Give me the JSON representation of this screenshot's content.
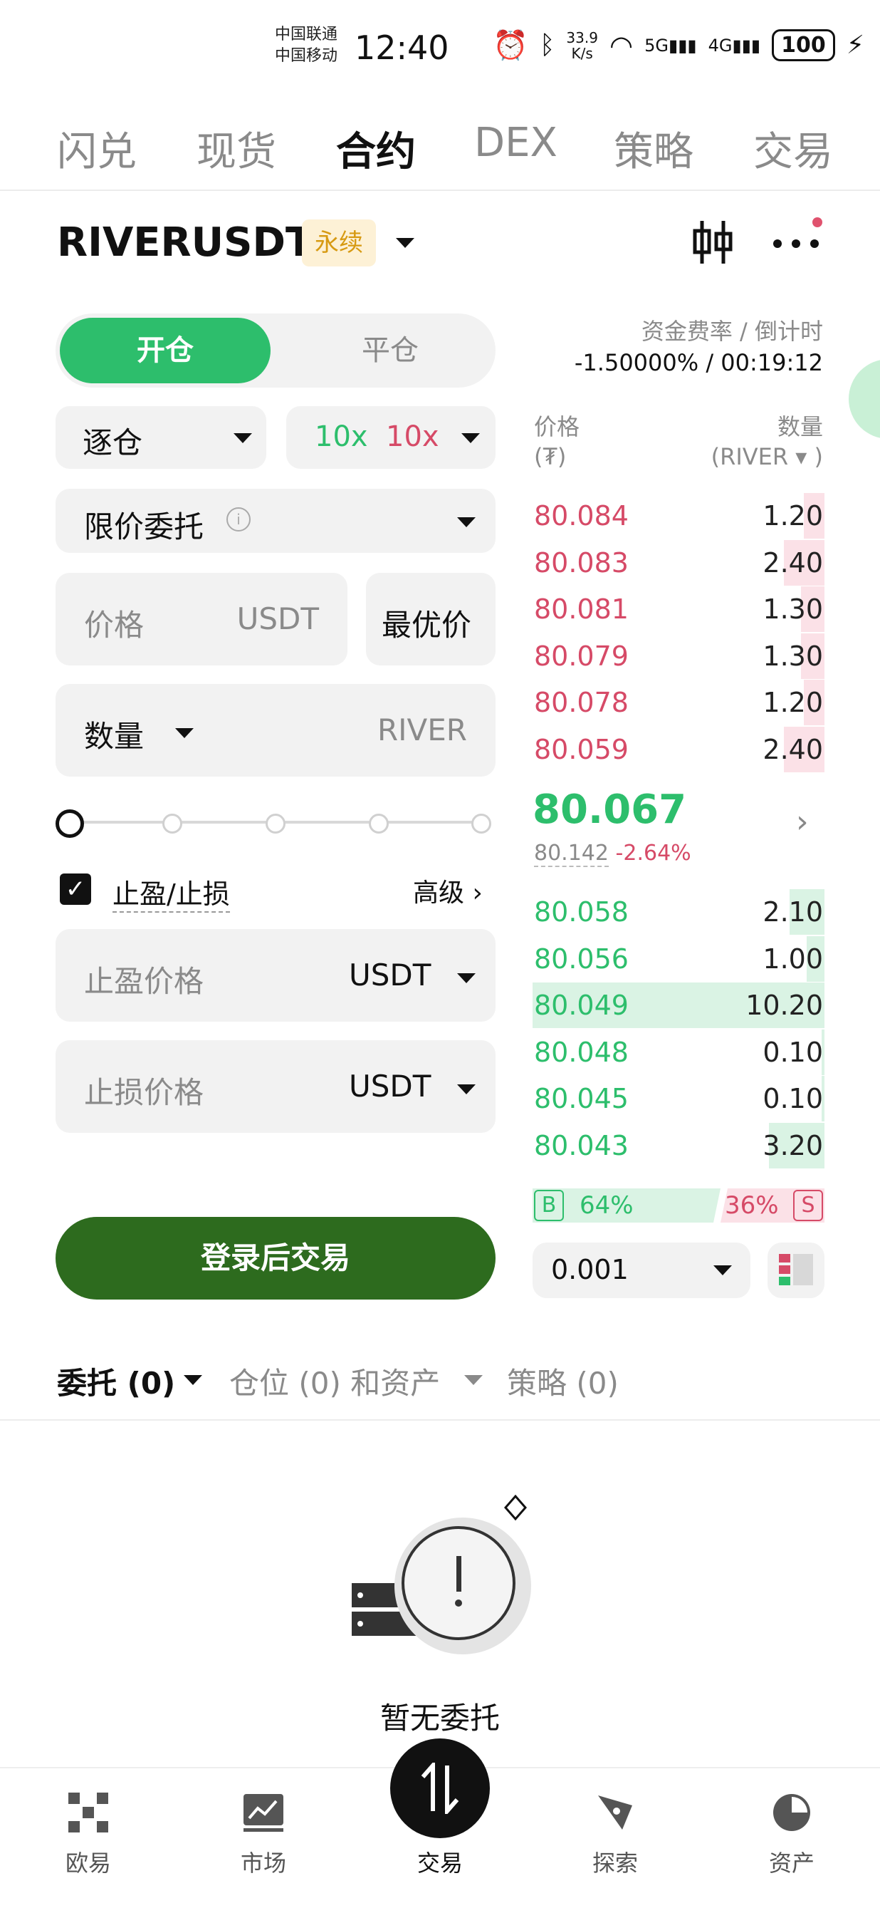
{
  "status_bar": {
    "carrier1": "中国联通",
    "carrier2": "中国移动",
    "time": "12:40",
    "net_speed_value": "33.9",
    "net_speed_unit": "K/s",
    "signal1": "5G",
    "signal2": "4G",
    "battery": "100"
  },
  "top_tabs": [
    "闪兑",
    "现货",
    "合约",
    "DEX",
    "策略",
    "交易"
  ],
  "active_tab": "合约",
  "pair": {
    "symbol": "RIVERUSDT",
    "badge": "永续"
  },
  "funding": {
    "label": "资金费率 / 倒计时",
    "value": "-1.50000% / 00:19:12"
  },
  "form": {
    "open_label": "开仓",
    "close_label": "平仓",
    "margin_mode": "逐仓",
    "leverage_long": "10x",
    "leverage_short": "10x",
    "order_type": "限价委托",
    "price_placeholder": "价格",
    "price_unit": "USDT",
    "best_price": "最优价",
    "qty_label": "数量",
    "qty_unit": "RIVER",
    "slider_percent": 0,
    "tpsl_label": "止盈/止损",
    "tpsl_checked": true,
    "advanced": "高级",
    "tp_placeholder": "止盈价格",
    "tp_unit": "USDT",
    "sl_placeholder": "止损价格",
    "sl_unit": "USDT",
    "login_button": "登录后交易"
  },
  "orderbook": {
    "price_header": "价格",
    "price_unit": "(₮)",
    "qty_header": "数量",
    "qty_unit": "(RIVER",
    "qty_unit_close": ")",
    "asks": [
      {
        "price": "80.084",
        "qty": "1.20",
        "depth": 0.07
      },
      {
        "price": "80.083",
        "qty": "2.40",
        "depth": 0.14
      },
      {
        "price": "80.081",
        "qty": "1.30",
        "depth": 0.08
      },
      {
        "price": "80.079",
        "qty": "1.30",
        "depth": 0.08
      },
      {
        "price": "80.078",
        "qty": "1.20",
        "depth": 0.07
      },
      {
        "price": "80.059",
        "qty": "2.40",
        "depth": 0.14
      }
    ],
    "last_price": "80.067",
    "mark_price": "80.142",
    "change": "-2.64%",
    "bids": [
      {
        "price": "80.058",
        "qty": "2.10",
        "depth": 0.12
      },
      {
        "price": "80.056",
        "qty": "1.00",
        "depth": 0.06
      },
      {
        "price": "80.049",
        "qty": "10.20",
        "depth": 1.0
      },
      {
        "price": "80.048",
        "qty": "0.10",
        "depth": 0.01
      },
      {
        "price": "80.045",
        "qty": "0.10",
        "depth": 0.01
      },
      {
        "price": "80.043",
        "qty": "3.20",
        "depth": 0.19
      }
    ],
    "buy_tag": "B",
    "buy_pct": "64%",
    "sell_pct": "36%",
    "sell_tag": "S",
    "precision": "0.001"
  },
  "bottom_tabs": {
    "orders": "委托 (0)",
    "positions": "仓位 (0) 和资产",
    "strategies": "策略 (0)"
  },
  "empty_state": {
    "text": "暂无委托"
  },
  "nav": [
    {
      "label": "欧易",
      "icon": "okx-logo-icon"
    },
    {
      "label": "市场",
      "icon": "market-chart-icon"
    },
    {
      "label": "交易",
      "icon": "trade-swap-icon"
    },
    {
      "label": "探索",
      "icon": "explore-compass-icon"
    },
    {
      "label": "资产",
      "icon": "assets-pie-icon"
    }
  ],
  "colors": {
    "green": "#2dbe6c",
    "red": "#d64a67",
    "login_button": "#2d6b1e",
    "badge_bg": "#fdf1d6",
    "badge_text": "#d79a12"
  }
}
